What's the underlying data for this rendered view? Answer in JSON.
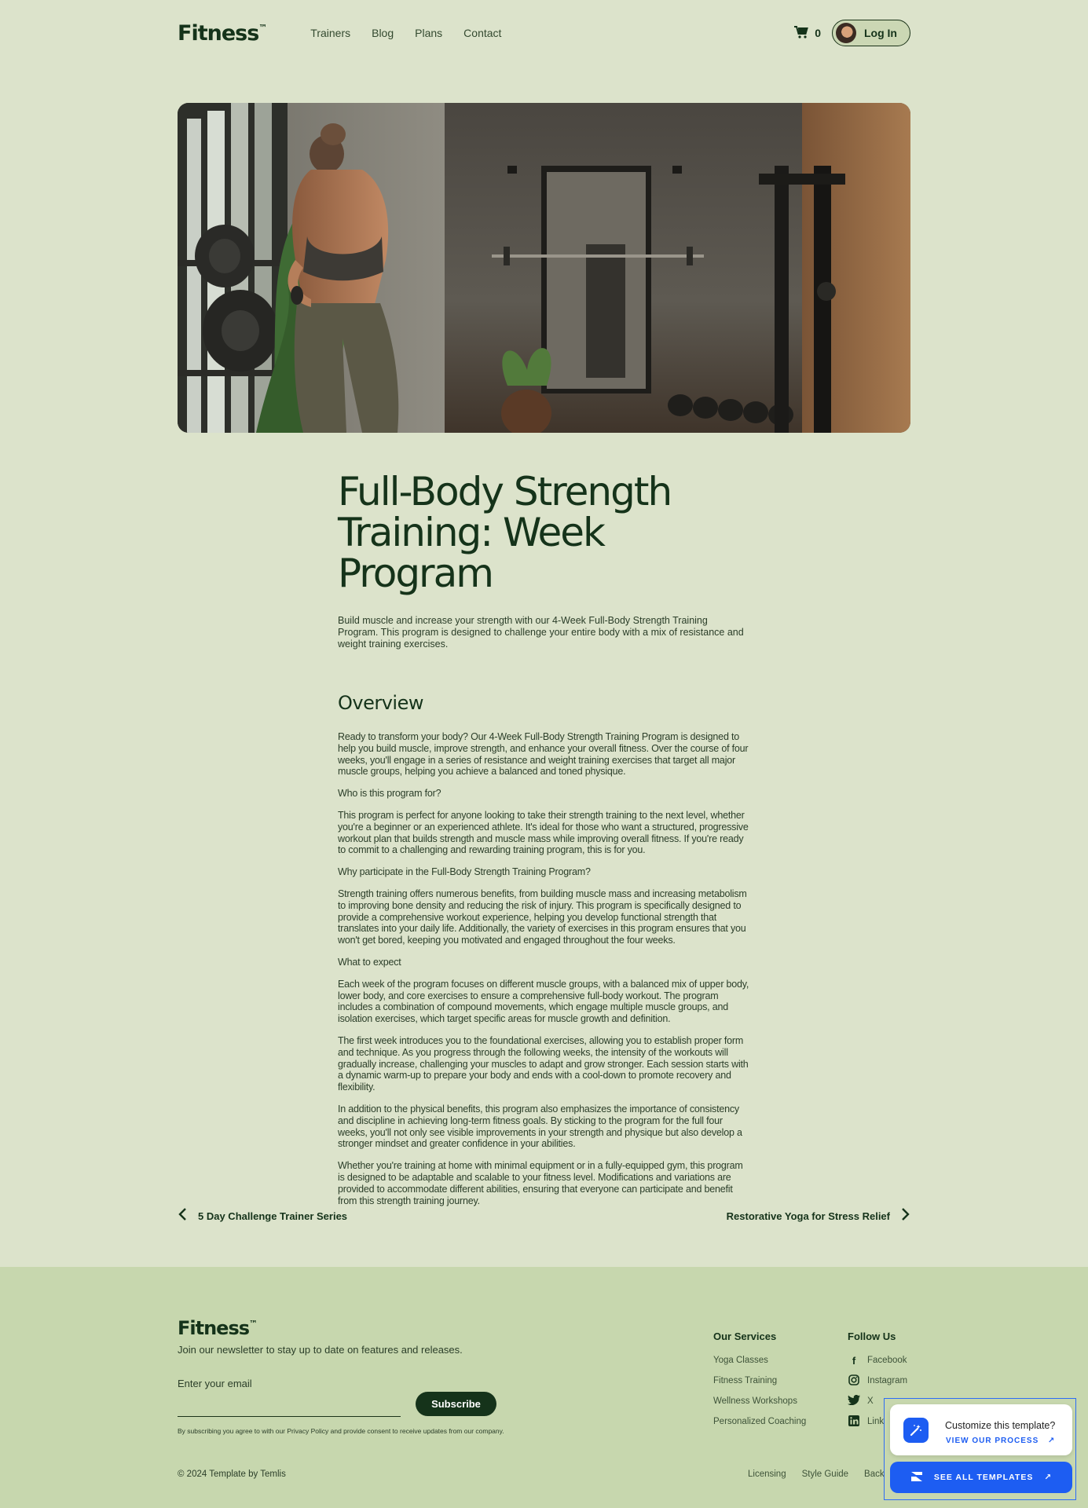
{
  "header": {
    "logo": "Fitness",
    "logo_mark": "™",
    "nav": [
      "Trainers",
      "Blog",
      "Plans",
      "Contact"
    ],
    "cart_count": "0",
    "login_label": "Log In"
  },
  "article": {
    "title_line1": "Full-Body Strength",
    "title_line2": "Training: Week Program",
    "lead": "Build muscle and increase your strength with our 4-Week Full-Body Strength Training Program. This program is designed to challenge your entire body with a mix of resistance and weight training exercises.",
    "overview_heading": "Overview",
    "paragraphs": [
      "Ready to transform your body? Our 4-Week Full-Body Strength Training Program is designed to help you build muscle, improve strength, and enhance your overall fitness. Over the course of four weeks, you'll engage in a series of resistance and weight training exercises that target all major muscle groups, helping you achieve a balanced and toned physique.",
      "Who is this program for?",
      "This program is perfect for anyone looking to take their strength training to the next level, whether you're a beginner or an experienced athlete. It's ideal for those who want a structured, progressive workout plan that builds strength and muscle mass while improving overall fitness. If you're ready to commit to a challenging and rewarding training program, this is for you.",
      "Why participate in the Full-Body Strength Training Program?",
      "Strength training offers numerous benefits, from building muscle mass and increasing metabolism to improving bone density and reducing the risk of injury. This program is specifically designed to provide a comprehensive workout experience, helping you develop functional strength that translates into your daily life. Additionally, the variety of exercises in this program ensures that you won't get bored, keeping you motivated and engaged throughout the four weeks.",
      "What to expect",
      "Each week of the program focuses on different muscle groups, with a balanced mix of upper body, lower body, and core exercises to ensure a comprehensive full-body workout. The program includes a combination of compound movements, which engage multiple muscle groups, and isolation exercises, which target specific areas for muscle growth and definition.",
      "The first week introduces you to the foundational exercises, allowing you to establish proper form and technique. As you progress through the following weeks, the intensity of the workouts will gradually increase, challenging your muscles to adapt and grow stronger. Each session starts with a dynamic warm-up to prepare your body and ends with a cool-down to promote recovery and flexibility.",
      "In addition to the physical benefits, this program also emphasizes the importance of consistency and discipline in achieving long-term fitness goals. By sticking to the program for the full four weeks, you'll not only see visible improvements in your strength and physique but also develop a stronger mindset and greater confidence in your abilities.",
      "Whether you're training at home with minimal equipment or in a fully-equipped gym, this program is designed to be adaptable and scalable to your fitness level. Modifications and variations are provided to accommodate different abilities, ensuring that everyone can participate and benefit from this strength training journey."
    ]
  },
  "postnav": {
    "prev": "5 Day Challenge Trainer Series",
    "next": "Restorative Yoga for Stress Relief"
  },
  "footer": {
    "logo": "Fitness",
    "logo_mark": "™",
    "tagline": "Join our newsletter to stay up to date on features and releases.",
    "email_placeholder": "Enter your email",
    "subscribe_label": "Subscribe",
    "legal": "By subscribing you agree to with our Privacy Policy and provide consent to receive updates from our company.",
    "services_heading": "Our Services",
    "services": [
      "Yoga Classes",
      "Fitness Training",
      "Wellness Workshops",
      "Personalized Coaching"
    ],
    "follow_heading": "Follow Us",
    "social": [
      "Facebook",
      "Instagram",
      "X",
      "Link"
    ],
    "copyright": "© 2024 Template by Temlis",
    "links": [
      "Licensing",
      "Style Guide",
      "Back"
    ]
  },
  "widget": {
    "title": "Customize this template?",
    "link": "VIEW OUR PROCESS",
    "button": "SEE ALL TEMPLATES"
  },
  "colors": {
    "background": "#dce3cb",
    "footer": "#c7d7ae",
    "primary": "#15331a",
    "accent_blue": "#1d5df2"
  }
}
